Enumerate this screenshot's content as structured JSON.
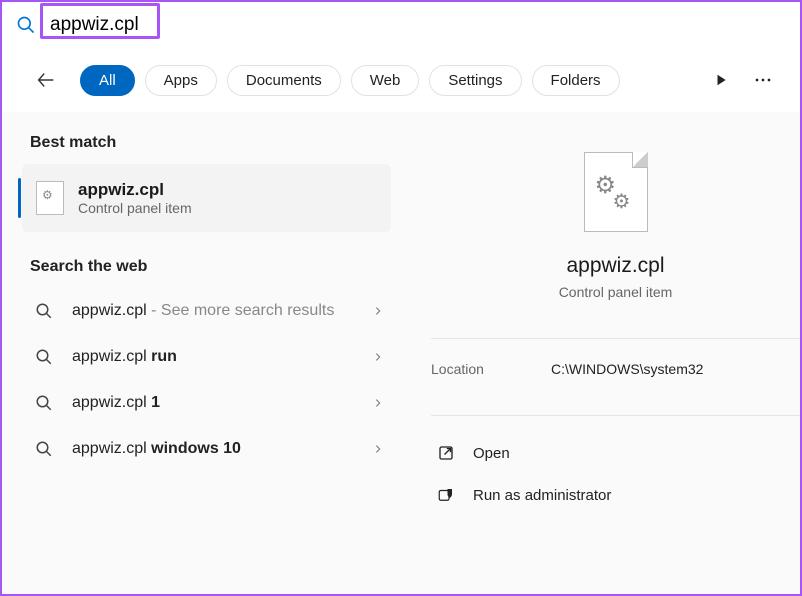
{
  "search": {
    "value": "appwiz.cpl"
  },
  "filters": {
    "items": [
      "All",
      "Apps",
      "Documents",
      "Web",
      "Settings",
      "Folders"
    ],
    "activeIndex": 0
  },
  "left": {
    "bestMatchHeader": "Best match",
    "bestMatch": {
      "title": "appwiz.cpl",
      "subtitle": "Control panel item"
    },
    "webHeader": "Search the web",
    "webItems": [
      {
        "prefix": "appwiz.cpl",
        "bold": "",
        "suffix": " - See more search results"
      },
      {
        "prefix": "appwiz.cpl ",
        "bold": "run",
        "suffix": ""
      },
      {
        "prefix": "appwiz.cpl ",
        "bold": "1",
        "suffix": ""
      },
      {
        "prefix": "appwiz.cpl ",
        "bold": "windows 10",
        "suffix": ""
      }
    ]
  },
  "right": {
    "title": "appwiz.cpl",
    "subtitle": "Control panel item",
    "locationLabel": "Location",
    "locationValue": "C:\\WINDOWS\\system32",
    "actions": [
      {
        "icon": "open-icon",
        "label": "Open"
      },
      {
        "icon": "shield-icon",
        "label": "Run as administrator"
      }
    ]
  }
}
